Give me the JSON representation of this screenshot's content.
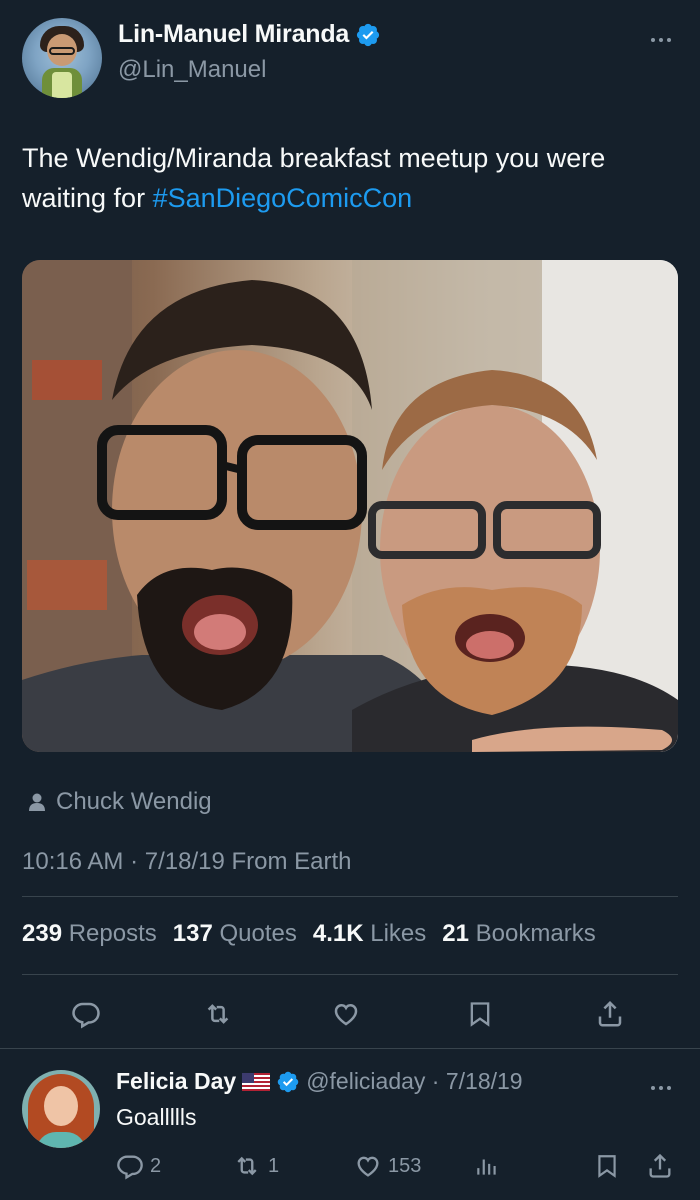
{
  "tweet": {
    "author": {
      "display_name": "Lin-Manuel Miranda",
      "handle": "@Lin_Manuel",
      "verified": true
    },
    "text_plain": "The Wendig/Miranda breakfast meetup you were waiting for ",
    "hashtag": "#SanDiegoComicCon",
    "tagged_person": "Chuck Wendig",
    "timestamp": "10:16 AM · 7/18/19 From Earth",
    "stats": [
      {
        "value": "239",
        "label": "Reposts"
      },
      {
        "value": "137",
        "label": "Quotes"
      },
      {
        "value": "4.1K",
        "label": "Likes"
      },
      {
        "value": "21",
        "label": "Bookmarks"
      }
    ],
    "actions": [
      {
        "icon": "reply-icon"
      },
      {
        "icon": "repost-icon"
      },
      {
        "icon": "like-icon"
      },
      {
        "icon": "bookmark-icon"
      },
      {
        "icon": "share-icon"
      }
    ]
  },
  "reply": {
    "author": {
      "display_name": "Felicia Day",
      "flag": "us-flag",
      "verified": true
    },
    "meta": "@feliciaday · 7/18/19",
    "text": "Goallllls",
    "actions": {
      "replies": "2",
      "reposts": "1",
      "likes": "153"
    }
  },
  "colors": {
    "background": "#15202b",
    "text_primary": "#f7f9f9",
    "text_secondary": "#8b98a5",
    "accent": "#1d9bf0",
    "divider": "#38444d"
  }
}
